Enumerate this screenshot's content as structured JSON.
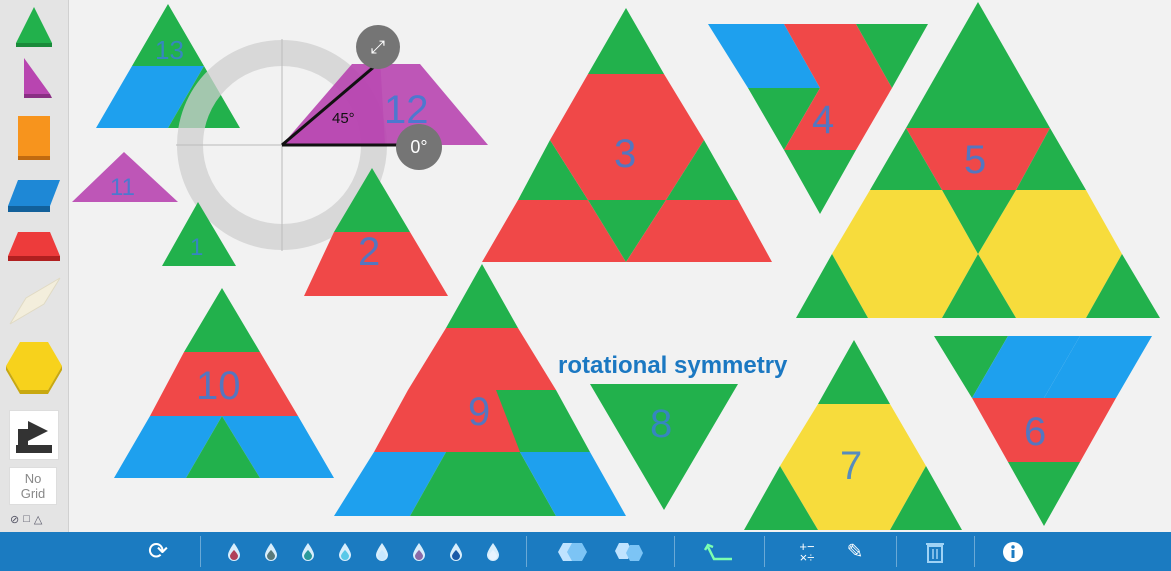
{
  "sidebar": {
    "tools": [
      {
        "name": "triangle-tool",
        "color": "#22b14c"
      },
      {
        "name": "right-triangle-tool",
        "color": "#b845b0"
      },
      {
        "name": "square-tool",
        "color": "#f7941d"
      },
      {
        "name": "parallelogram-tool",
        "color": "#1e88d6"
      },
      {
        "name": "trapezoid-tool",
        "color": "#ed3b3b"
      },
      {
        "name": "rhombus-tool",
        "color": "#f3eedc"
      },
      {
        "name": "hexagon-tool",
        "color": "#f7d21c"
      }
    ],
    "no_grid_line1": "No",
    "no_grid_line2": "Grid",
    "grid_options": [
      "⊘",
      "□",
      "△"
    ]
  },
  "canvas": {
    "labels": [
      "13",
      "12",
      "11",
      "1",
      "2",
      "3",
      "4",
      "5",
      "10",
      "9",
      "8",
      "7",
      "6"
    ],
    "angle_label": "45°",
    "rotate_dial_label": "0°",
    "annotation": "rotational symmetry"
  },
  "colors": {
    "green": "#22b14c",
    "red": "#f04848",
    "blue": "#1ea0ee",
    "yellow": "#f7dc3c",
    "purple": "#b845b0",
    "toolbar": "#1b7bc1"
  },
  "toolbar": {
    "icons": [
      "refresh-icon",
      "color-drop-icon",
      "color-drop-icon",
      "color-drop-icon",
      "color-drop-icon",
      "color-drop-icon",
      "color-drop-icon",
      "color-drop-icon",
      "color-drop-icon",
      "group-icon",
      "ungroup-icon",
      "undo-icon",
      "calculator-icon",
      "pencil-icon",
      "trash-icon",
      "info-icon"
    ],
    "drop_colors": [
      "#b0405a",
      "#5a7a7a",
      "#2a9a9a",
      "#5ac8e8",
      "#c8e8ff",
      "#8a6aa8",
      "#1a5aa8",
      "#e8f4ff"
    ]
  }
}
